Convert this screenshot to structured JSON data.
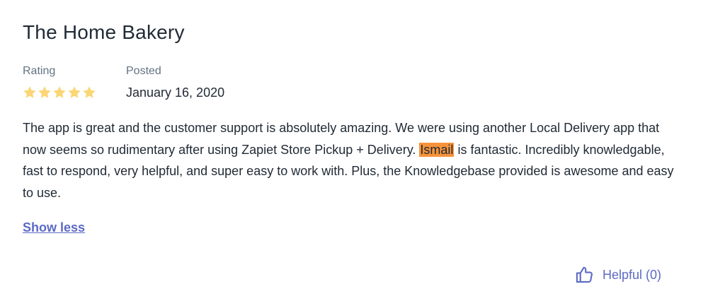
{
  "review": {
    "store_name": "The Home Bakery",
    "rating_label": "Rating",
    "rating_value": 5,
    "rating_max": 5,
    "posted_label": "Posted",
    "posted_date": "January 16, 2020",
    "body_before": "The app is great and the customer support is absolutely amazing. We were using another Local Delivery app that now seems so rudimentary after using Zapiet Store Pickup + Delivery. ",
    "body_highlight": "Ismail",
    "body_after": " is fantastic. Incredibly knowledgable, fast to respond, very helpful, and super easy to work with. Plus, the Knowledgebase provided is awesome and easy to use.",
    "show_less_label": "Show less",
    "helpful_label": "Helpful (0)"
  },
  "colors": {
    "star": "#fbd675",
    "link": "#5c6ac4",
    "highlight": "#f7933b",
    "text": "#212b36",
    "muted": "#637381"
  },
  "icons": {
    "star": "star-icon",
    "helpful": "thumbs-up-icon"
  }
}
